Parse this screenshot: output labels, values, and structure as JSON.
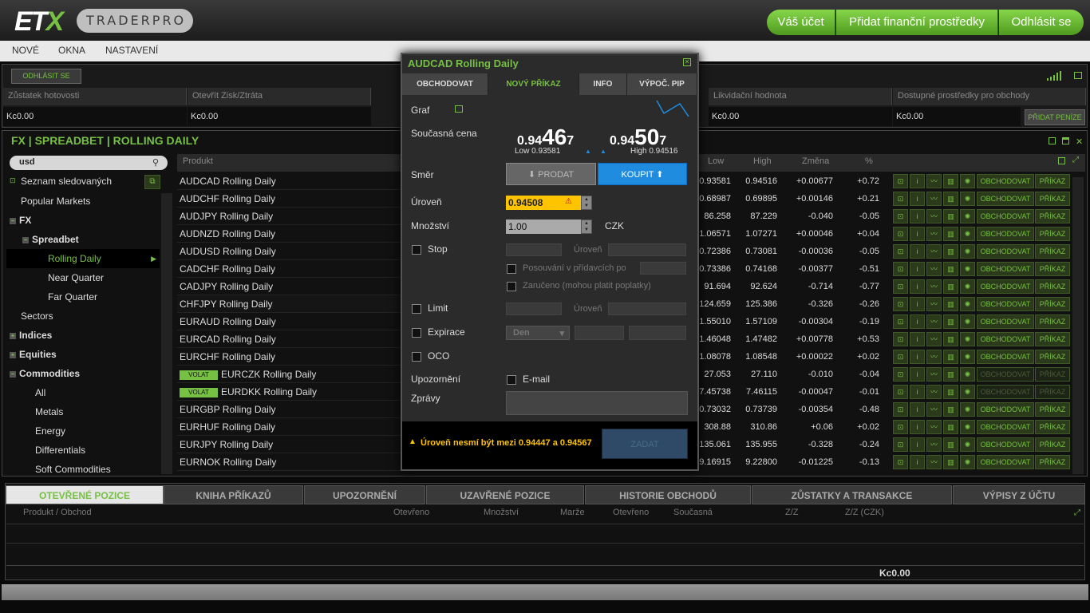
{
  "header": {
    "logo_text": "ETX",
    "logo_sub": "TRADERPRO",
    "btn_account": "Váš účet",
    "btn_funds": "Přidat finanční prostředky",
    "btn_logout": "Odhlásit se"
  },
  "menu": [
    "NOVÉ",
    "OKNA",
    "NASTAVENÍ"
  ],
  "account": {
    "login_btn": "ODHLÁSIT SE",
    "labels": [
      "Zůstatek hotovosti",
      "Otevřít Zisk/Ztráta",
      "Likvidační hodnota",
      "Dostupné prostředky pro obchody"
    ],
    "values": [
      "Kc0.00",
      "Kc0.00",
      "Kc0.00",
      "Kc0.00"
    ],
    "add_funds": "PŘIDAT PENÍZE"
  },
  "market": {
    "title": "FX | SPREADBET | ROLLING DAILY",
    "search": "usd",
    "watchlist": "Seznam sledovaných",
    "tree": [
      "Popular Markets",
      "FX",
      "Spreadbet",
      "Rolling Daily",
      "Near Quarter",
      "Far Quarter",
      "Sectors",
      "Indices",
      "Equities",
      "Commodities",
      "All",
      "Metals",
      "Energy",
      "Differentials",
      "Soft Commodities"
    ],
    "col_product": "Produkt",
    "col_low": "Low",
    "col_high": "High",
    "col_change": "Změna",
    "col_pct": "%",
    "volat": "VOLAT",
    "trade": "OBCHODOVAT",
    "order": "PŘÍKAZ",
    "rows": [
      {
        "name": "AUDCAD Rolling Daily",
        "low": "0.93581",
        "high": "0.94516",
        "chg": "+0.00677",
        "pct": "+0.72"
      },
      {
        "name": "AUDCHF Rolling Daily",
        "low": "0.68987",
        "high": "0.69895",
        "chg": "+0.00146",
        "pct": "+0.21"
      },
      {
        "name": "AUDJPY  Rolling Daily",
        "low": "86.258",
        "high": "87.229",
        "chg": "-0.040",
        "pct": "-0.05"
      },
      {
        "name": "AUDNZD Rolling Daily",
        "low": "1.06571",
        "high": "1.07271",
        "chg": "+0.00046",
        "pct": "+0.04"
      },
      {
        "name": "AUDUSD Rolling Daily",
        "low": "0.72386",
        "high": "0.73081",
        "chg": "-0.00036",
        "pct": "-0.05"
      },
      {
        "name": "CADCHF Rolling Daily",
        "low": "0.73386",
        "high": "0.74168",
        "chg": "-0.00377",
        "pct": "-0.51"
      },
      {
        "name": "CADJPY  Rolling Daily",
        "low": "91.694",
        "high": "92.624",
        "chg": "-0.714",
        "pct": "-0.77"
      },
      {
        "name": "CHFJPY  Rolling Daily",
        "low": "124.659",
        "high": "125.386",
        "chg": "-0.326",
        "pct": "-0.26"
      },
      {
        "name": "EURAUD Rolling Daily",
        "low": "1.55010",
        "high": "1.57109",
        "chg": "-0.00304",
        "pct": "-0.19"
      },
      {
        "name": "EURCAD Rolling Daily",
        "low": "1.46048",
        "high": "1.47482",
        "chg": "+0.00778",
        "pct": "+0.53"
      },
      {
        "name": "EURCHF Rolling Daily",
        "low": "1.08078",
        "high": "1.08548",
        "chg": "+0.00022",
        "pct": "+0.02"
      },
      {
        "name": "EURCZK Rolling Daily",
        "low": "27.053",
        "high": "27.110",
        "chg": "-0.010",
        "pct": "-0.04"
      },
      {
        "name": "EURDKK Rolling Daily",
        "low": "7.45738",
        "high": "7.46115",
        "chg": "-0.00047",
        "pct": "-0.01"
      },
      {
        "name": "EURGBP Rolling Daily",
        "low": "0.73032",
        "high": "0.73739",
        "chg": "-0.00354",
        "pct": "-0.48"
      },
      {
        "name": "EURHUF Rolling Daily",
        "low": "308.88",
        "high": "310.86",
        "chg": "+0.06",
        "pct": "+0.02"
      },
      {
        "name": "EURJPY  Rolling Daily",
        "low": "135.061",
        "high": "135.955",
        "chg": "-0.328",
        "pct": "-0.24"
      },
      {
        "name": "EURNOK Rolling Daily",
        "low": "9.16915",
        "high": "9.22800",
        "chg": "-0.01225",
        "pct": "-0.13"
      }
    ]
  },
  "ticket": {
    "title": "AUDCAD Rolling Daily",
    "tabs": [
      "OBCHODOVAT",
      "NOVÝ PŘÍKAZ",
      "INFO",
      "VÝPOČ. PIP"
    ],
    "graf": "Graf",
    "current_price": "Současná cena",
    "sell_a": "0.94",
    "sell_b": "46",
    "sell_c": "7",
    "buy_a": "0.94",
    "buy_b": "50",
    "buy_c": "7",
    "low_lbl": "Low 0.93581",
    "high_lbl": "High 0.94516",
    "direction": "Směr",
    "sell": "PRODAT",
    "buy": "KOUPIT",
    "level": "Úroveň",
    "level_value": "0.94508",
    "qty": "Množství",
    "qty_value": "1.00",
    "currency": "CZK",
    "stop": "Stop",
    "stop_level": "Úroveň",
    "trailing": "Posouvání v přídavcích po",
    "guaranteed": "Zaručeno  (mohou platit poplatky)",
    "limit": "Limit",
    "limit_level": "Úroveň",
    "expiry": "Expirace",
    "expiry_val": "Den",
    "oco": "OCO",
    "alert": "Upozornění",
    "email": "E-mail",
    "messages": "Zprávy",
    "warning": "Úroveň nesmí být mezi 0.94447 a 0.94567",
    "submit": "ZADAT"
  },
  "bottom": {
    "tabs": [
      "OTEVŘENÉ POZICE",
      "KNIHA PŘÍKAZŮ",
      "UPOZORNĚNÍ",
      "UZAVŘENÉ POZICE",
      "HISTORIE OBCHODŮ",
      "ZŮSTATKY A TRANSAKCE",
      "VÝPISY Z ÚČTU"
    ],
    "cols": [
      "Produkt / Obchod",
      "Otevřeno",
      "Množství",
      "Marže",
      "Otevřeno",
      "Současná",
      "Z/Z",
      "Z/Z (CZK)"
    ],
    "total": "Kc0.00"
  }
}
